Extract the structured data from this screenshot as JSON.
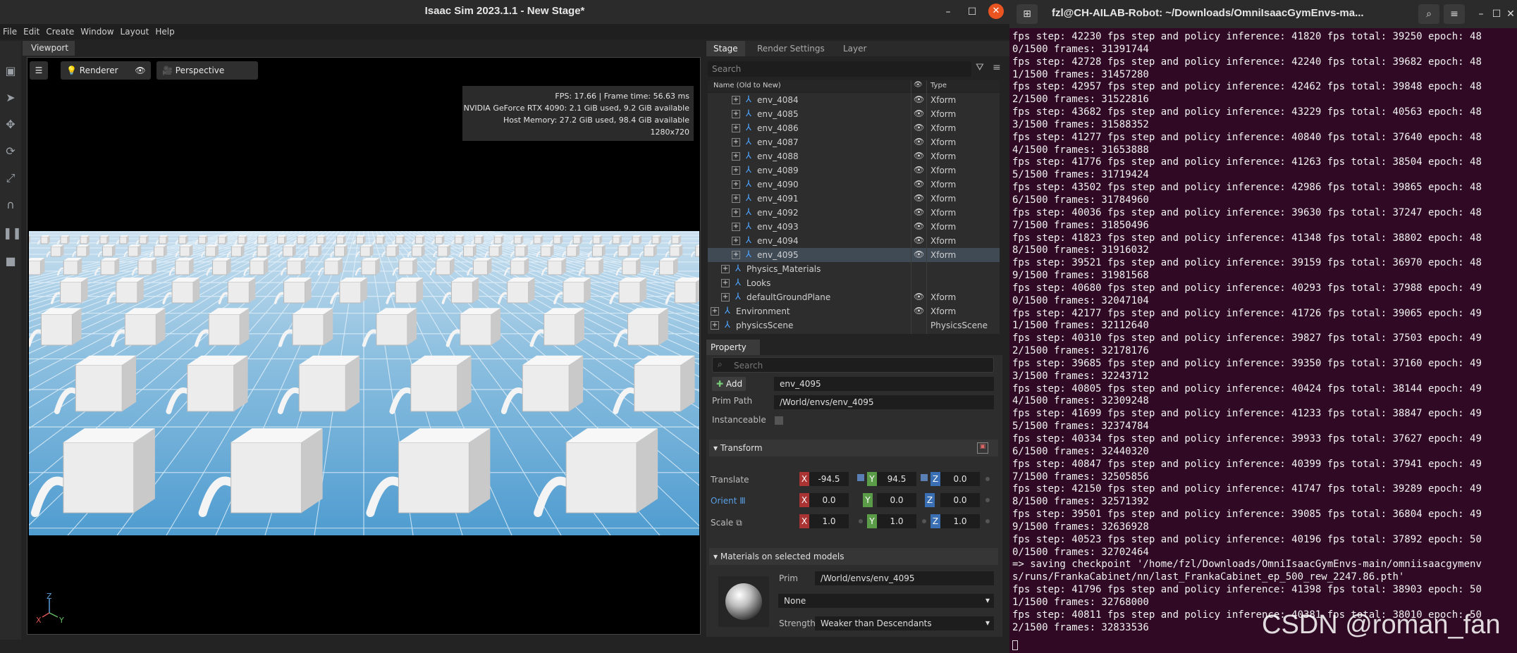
{
  "isaac": {
    "title": "Isaac Sim 2023.1.1 - New Stage*",
    "menu": [
      "File",
      "Edit",
      "Create",
      "Window",
      "Layout",
      "Help"
    ],
    "viewport_tab": "Viewport",
    "renderer_label": "Renderer",
    "camera_label": "Perspective",
    "stats": {
      "line1": "FPS: 17.66 | Frame time: 56.63 ms",
      "line2": "NVIDIA GeForce RTX 4090: 2.1 GiB used, 9.2 GiB available",
      "line3": "Host Memory: 27.2 GiB used, 98.4 GiB available",
      "line4": "1280x720"
    },
    "gizmo": {
      "x": "X",
      "y": "Y",
      "z": "Z"
    }
  },
  "stage": {
    "tabs": [
      "Stage",
      "Render Settings",
      "Layer"
    ],
    "search_placeholder": "Search",
    "col_name": "Name (Old to New)",
    "col_type": "Type",
    "rows": [
      {
        "name": "env_4084",
        "type": "Xform",
        "eye": true,
        "level": 2
      },
      {
        "name": "env_4085",
        "type": "Xform",
        "eye": true,
        "level": 2
      },
      {
        "name": "env_4086",
        "type": "Xform",
        "eye": true,
        "level": 2
      },
      {
        "name": "env_4087",
        "type": "Xform",
        "eye": true,
        "level": 2
      },
      {
        "name": "env_4088",
        "type": "Xform",
        "eye": true,
        "level": 2
      },
      {
        "name": "env_4089",
        "type": "Xform",
        "eye": true,
        "level": 2
      },
      {
        "name": "env_4090",
        "type": "Xform",
        "eye": true,
        "level": 2
      },
      {
        "name": "env_4091",
        "type": "Xform",
        "eye": true,
        "level": 2
      },
      {
        "name": "env_4092",
        "type": "Xform",
        "eye": true,
        "level": 2
      },
      {
        "name": "env_4093",
        "type": "Xform",
        "eye": true,
        "level": 2
      },
      {
        "name": "env_4094",
        "type": "Xform",
        "eye": true,
        "level": 2
      },
      {
        "name": "env_4095",
        "type": "Xform",
        "eye": true,
        "level": 2,
        "selected": true
      },
      {
        "name": "Physics_Materials",
        "type": "",
        "eye": false,
        "level": 1
      },
      {
        "name": "Looks",
        "type": "",
        "eye": false,
        "level": 1
      },
      {
        "name": "defaultGroundPlane",
        "type": "Xform",
        "eye": true,
        "level": 1
      },
      {
        "name": "Environment",
        "type": "Xform",
        "eye": true,
        "level": 0
      },
      {
        "name": "physicsScene",
        "type": "PhysicsScene",
        "eye": false,
        "level": 0
      }
    ]
  },
  "property": {
    "tab": "Property",
    "search_placeholder": "Search",
    "add_label": "Add",
    "prim_name": "env_4095",
    "prim_path_label": "Prim Path",
    "prim_path": "/World/envs/env_4095",
    "instanceable_label": "Instanceable",
    "transform_label": "Transform",
    "translate_label": "Translate",
    "orient_label": "Orient",
    "scale_label": "Scale",
    "translate": {
      "x": "-94.5",
      "y": "94.5",
      "z": "0.0"
    },
    "orient": {
      "x": "0.0",
      "y": "0.0",
      "z": "0.0"
    },
    "scale": {
      "x": "1.0",
      "y": "1.0",
      "z": "1.0"
    },
    "materials_label": "Materials on selected models",
    "prim_label": "Prim",
    "material_prim": "/World/envs/env_4095",
    "material_value": "None",
    "strength_label": "Strength",
    "strength_value": "Weaker than Descendants"
  },
  "terminal": {
    "title": "fzl@CH-AILAB-Robot: ~/Downloads/OmniIsaacGymEnvs-ma...",
    "lines": [
      "fps step: 42230 fps step and policy inference: 41820 fps total: 39250 epoch: 48",
      "0/1500 frames: 31391744",
      "fps step: 42728 fps step and policy inference: 42240 fps total: 39682 epoch: 48",
      "1/1500 frames: 31457280",
      "fps step: 42957 fps step and policy inference: 42462 fps total: 39848 epoch: 48",
      "2/1500 frames: 31522816",
      "fps step: 43682 fps step and policy inference: 43229 fps total: 40563 epoch: 48",
      "3/1500 frames: 31588352",
      "fps step: 41277 fps step and policy inference: 40840 fps total: 37640 epoch: 48",
      "4/1500 frames: 31653888",
      "fps step: 41776 fps step and policy inference: 41263 fps total: 38504 epoch: 48",
      "5/1500 frames: 31719424",
      "fps step: 43502 fps step and policy inference: 42986 fps total: 39865 epoch: 48",
      "6/1500 frames: 31784960",
      "fps step: 40036 fps step and policy inference: 39630 fps total: 37247 epoch: 48",
      "7/1500 frames: 31850496",
      "fps step: 41823 fps step and policy inference: 41348 fps total: 38802 epoch: 48",
      "8/1500 frames: 31916032",
      "fps step: 39521 fps step and policy inference: 39159 fps total: 36970 epoch: 48",
      "9/1500 frames: 31981568",
      "fps step: 40680 fps step and policy inference: 40293 fps total: 37988 epoch: 49",
      "0/1500 frames: 32047104",
      "fps step: 42177 fps step and policy inference: 41726 fps total: 39065 epoch: 49",
      "1/1500 frames: 32112640",
      "fps step: 40310 fps step and policy inference: 39827 fps total: 37503 epoch: 49",
      "2/1500 frames: 32178176",
      "fps step: 39685 fps step and policy inference: 39350 fps total: 37160 epoch: 49",
      "3/1500 frames: 32243712",
      "fps step: 40805 fps step and policy inference: 40424 fps total: 38144 epoch: 49",
      "4/1500 frames: 32309248",
      "fps step: 41699 fps step and policy inference: 41233 fps total: 38847 epoch: 49",
      "5/1500 frames: 32374784",
      "fps step: 40334 fps step and policy inference: 39933 fps total: 37627 epoch: 49",
      "6/1500 frames: 32440320",
      "fps step: 40847 fps step and policy inference: 40399 fps total: 37941 epoch: 49",
      "7/1500 frames: 32505856",
      "fps step: 42150 fps step and policy inference: 41747 fps total: 39289 epoch: 49",
      "8/1500 frames: 32571392",
      "fps step: 39501 fps step and policy inference: 39085 fps total: 36804 epoch: 49",
      "9/1500 frames: 32636928",
      "fps step: 40523 fps step and policy inference: 40196 fps total: 37892 epoch: 50",
      "0/1500 frames: 32702464",
      "=> saving checkpoint '/home/fzl/Downloads/OmniIsaacGymEnvs-main/omniisaacgymenv",
      "s/runs/FrankaCabinet/nn/last_FrankaCabinet_ep_500_rew_2247.86.pth'",
      "fps step: 41796 fps step and policy inference: 41398 fps total: 38903 epoch: 50",
      "1/1500 frames: 32768000",
      "fps step: 40811 fps step and policy inference: 40381 fps total: 38010 epoch: 50",
      "2/1500 frames: 32833536"
    ],
    "watermark": "CSDN @roman_fan"
  }
}
